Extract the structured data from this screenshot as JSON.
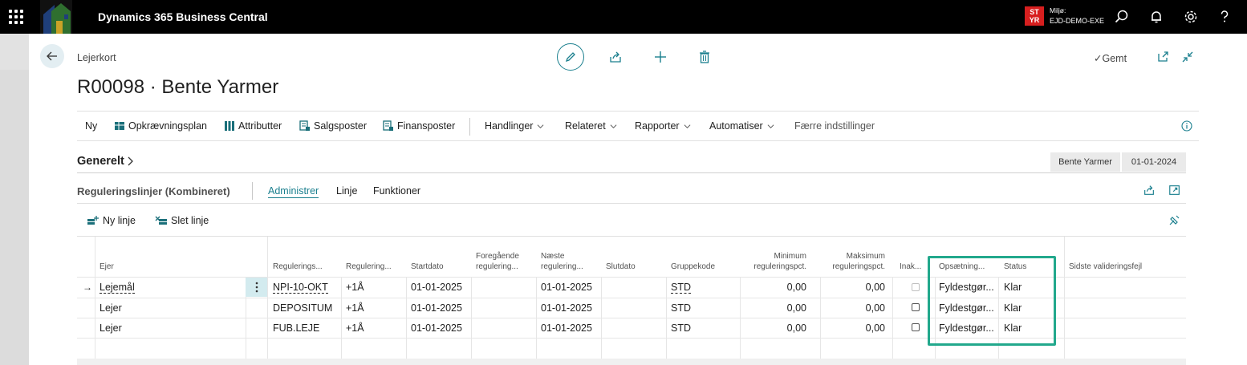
{
  "app": {
    "title": "Dynamics 365 Business Central"
  },
  "environment": {
    "badge_line1": "ST",
    "badge_line2": "YR",
    "label": "Miljø:",
    "name": "EJD-DEMO-EXE"
  },
  "icons": {
    "waffle": "app-launcher-icon",
    "search": "search-icon",
    "bell": "bell-icon",
    "settings": "gear-icon",
    "help": "help-icon"
  },
  "header": {
    "breadcrumb": "Lejerkort",
    "title": "R00098 · Bente Yarmer",
    "saved": "Gemt"
  },
  "actions": {
    "ny": "Ny",
    "opkraevningsplan": "Opkrævningsplan",
    "attributter": "Attributter",
    "salgsposter": "Salgsposter",
    "finansposter": "Finansposter",
    "handlinger": "Handlinger",
    "relateret": "Relateret",
    "rapporter": "Rapporter",
    "automatiser": "Automatiser",
    "faerre": "Færre indstillinger"
  },
  "general": {
    "title": "Generelt",
    "name_pill": "Bente Yarmer",
    "date_pill": "01-01-2024"
  },
  "part": {
    "title": "Reguleringslinjer (Kombineret)",
    "tabs": [
      "Administrer",
      "Linje",
      "Funktioner"
    ],
    "new_line": "Ny linje",
    "delete_line": "Slet linje"
  },
  "columns": {
    "ejer": "Ejer",
    "regulerings": "Regulerings...",
    "regulering": "Regulering...",
    "startdato": "Startdato",
    "foregaaende1": "Foregående",
    "foregaaende2": "regulering...",
    "naeste1": "Næste",
    "naeste2": "regulering...",
    "slutdato": "Slutdato",
    "gruppekode": "Gruppekode",
    "min1": "Minimum",
    "min2": "reguleringspct.",
    "max1": "Maksimum",
    "max2": "reguleringspct.",
    "inak": "Inak...",
    "opsaetning": "Opsætning...",
    "status": "Status",
    "fejl": "Sidste valideringsfejl"
  },
  "rows": [
    {
      "ejer": "Lejemål",
      "kode": "NPI-10-OKT",
      "reg": "+1Å",
      "start": "01-01-2025",
      "naeste": "01-01-2025",
      "gruppe": "STD",
      "min": "0,00",
      "max": "0,00",
      "ops": "Fyldestgør...",
      "status": "Klar"
    },
    {
      "ejer": "Lejer",
      "kode": "DEPOSITUM",
      "reg": "+1Å",
      "start": "01-01-2025",
      "naeste": "01-01-2025",
      "gruppe": "STD",
      "min": "0,00",
      "max": "0,00",
      "ops": "Fyldestgør...",
      "status": "Klar"
    },
    {
      "ejer": "Lejer",
      "kode": "FUB.LEJE",
      "reg": "+1Å",
      "start": "01-01-2025",
      "naeste": "01-01-2025",
      "gruppe": "STD",
      "min": "0,00",
      "max": "0,00",
      "ops": "Fyldestgør...",
      "status": "Klar"
    }
  ]
}
